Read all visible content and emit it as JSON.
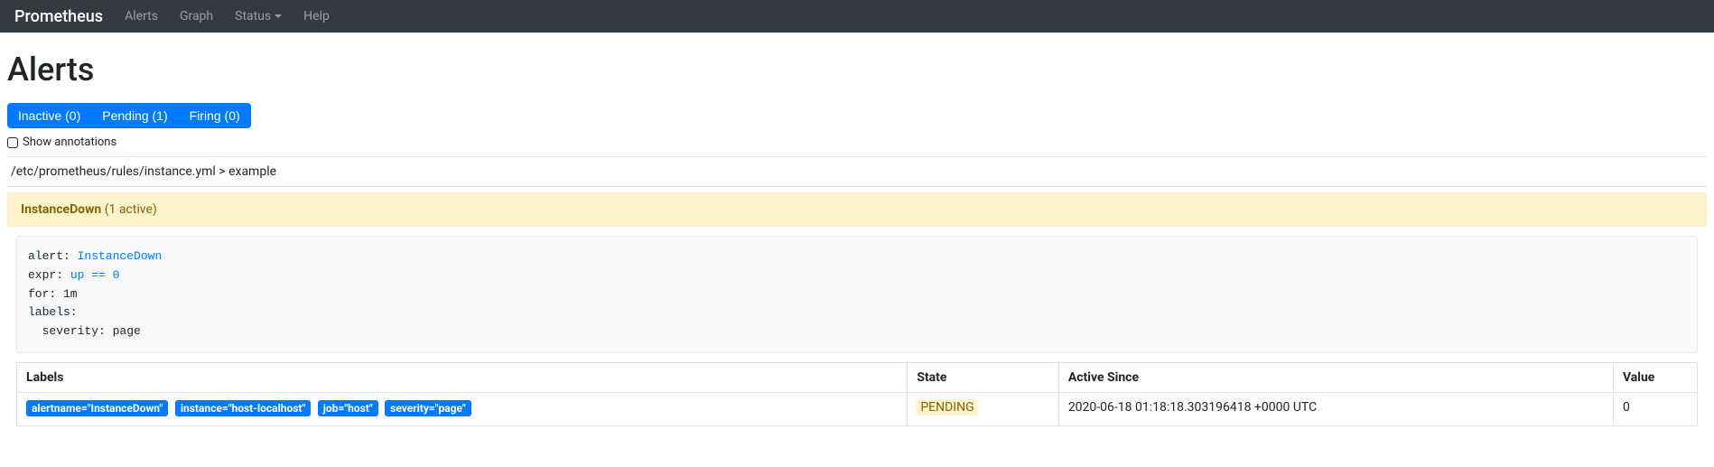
{
  "navbar": {
    "brand": "Prometheus",
    "items": {
      "alerts": "Alerts",
      "graph": "Graph",
      "status": "Status",
      "help": "Help"
    }
  },
  "page": {
    "title": "Alerts"
  },
  "filters": {
    "inactive": "Inactive (0)",
    "pending": "Pending (1)",
    "firing": "Firing (0)"
  },
  "show_annotations_label": "Show annotations",
  "rule_path": "/etc/prometheus/rules/instance.yml > example",
  "alert": {
    "name": "InstanceDown",
    "count_text": "(1 active)",
    "rule_yaml": {
      "alert_key": "alert:",
      "alert_val": "InstanceDown",
      "expr_key": "expr:",
      "expr_val": "up == 0",
      "for_line": "for: 1m",
      "labels_line": "labels:",
      "severity_line": "  severity: page"
    }
  },
  "table": {
    "headers": {
      "labels": "Labels",
      "state": "State",
      "active_since": "Active Since",
      "value": "Value"
    },
    "row": {
      "labels": {
        "alertname": "alertname=\"InstanceDown\"",
        "instance": "instance=\"host-localhost\"",
        "job": "job=\"host\"",
        "severity": "severity=\"page\""
      },
      "state": "PENDING",
      "active_since": "2020-06-18 01:18:18.303196418 +0000 UTC",
      "value": "0"
    }
  }
}
